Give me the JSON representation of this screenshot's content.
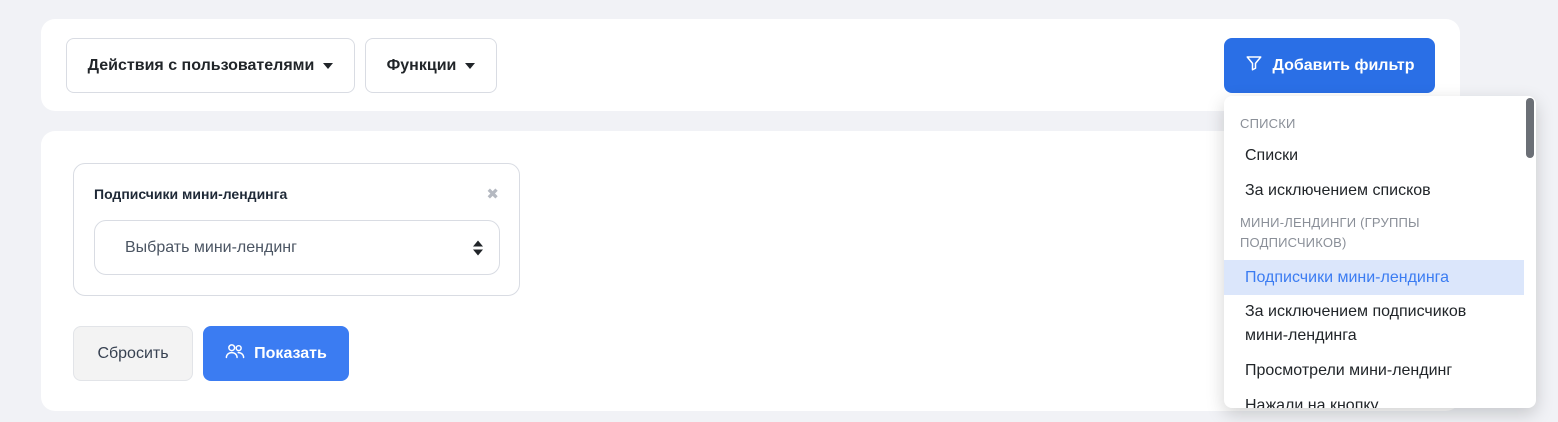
{
  "toolbar": {
    "user_actions_label": "Действия с пользователями",
    "functions_label": "Функции",
    "add_filter_label": "Добавить фильтр"
  },
  "filter": {
    "title": "Подписчики мини-лендинга",
    "select_value": "Выбрать мини-лендинг",
    "close_glyph": "✖"
  },
  "actions": {
    "reset_label": "Сбросить",
    "show_label": "Показать"
  },
  "menu": {
    "group_lists_header": "СПИСКИ",
    "lists_item": "Списки",
    "except_lists_item": "За исключением списков",
    "group_landing_header_line1": "МИНИ-ЛЕНДИНГИ (ГРУППЫ",
    "group_landing_header_line2": "ПОДПИСЧИКОВ)",
    "landing_subscribers_item": "Подписчики мини-лендинга",
    "except_landing_line1": "За исключением подписчиков",
    "except_landing_line2": "мини-лендинга",
    "viewed_landing_item": "Просмотрели мини-лендинг",
    "clicked_button_item": "Нажали на кнопку"
  },
  "colors": {
    "primary": "#2a6fe6",
    "primary_light": "#3b7cf2",
    "active_bg": "#dbe6fb"
  },
  "icons": {
    "filter": "filter-icon",
    "users": "users-icon",
    "caret": "caret-down-icon",
    "close": "close-icon",
    "select_arrows": "select-arrows-icon"
  }
}
